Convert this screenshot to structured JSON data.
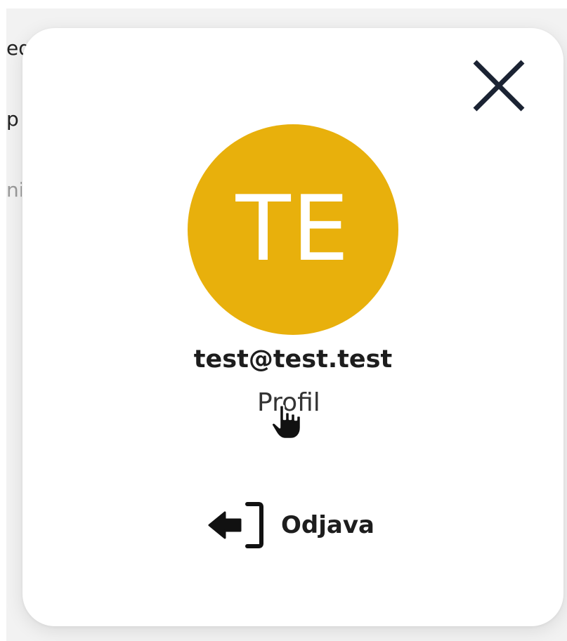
{
  "background": {
    "fragments": [
      "ed",
      "p",
      "ni"
    ]
  },
  "profile_panel": {
    "avatar": {
      "initials": "TE",
      "color": "#e8b00c"
    },
    "user_email": "test@test.test",
    "profile_link_label": "Profil",
    "logout_label": "Odjava",
    "icons": {
      "close": "close-icon",
      "logout": "logout-icon",
      "pointer": "hand-pointer-cursor"
    }
  }
}
